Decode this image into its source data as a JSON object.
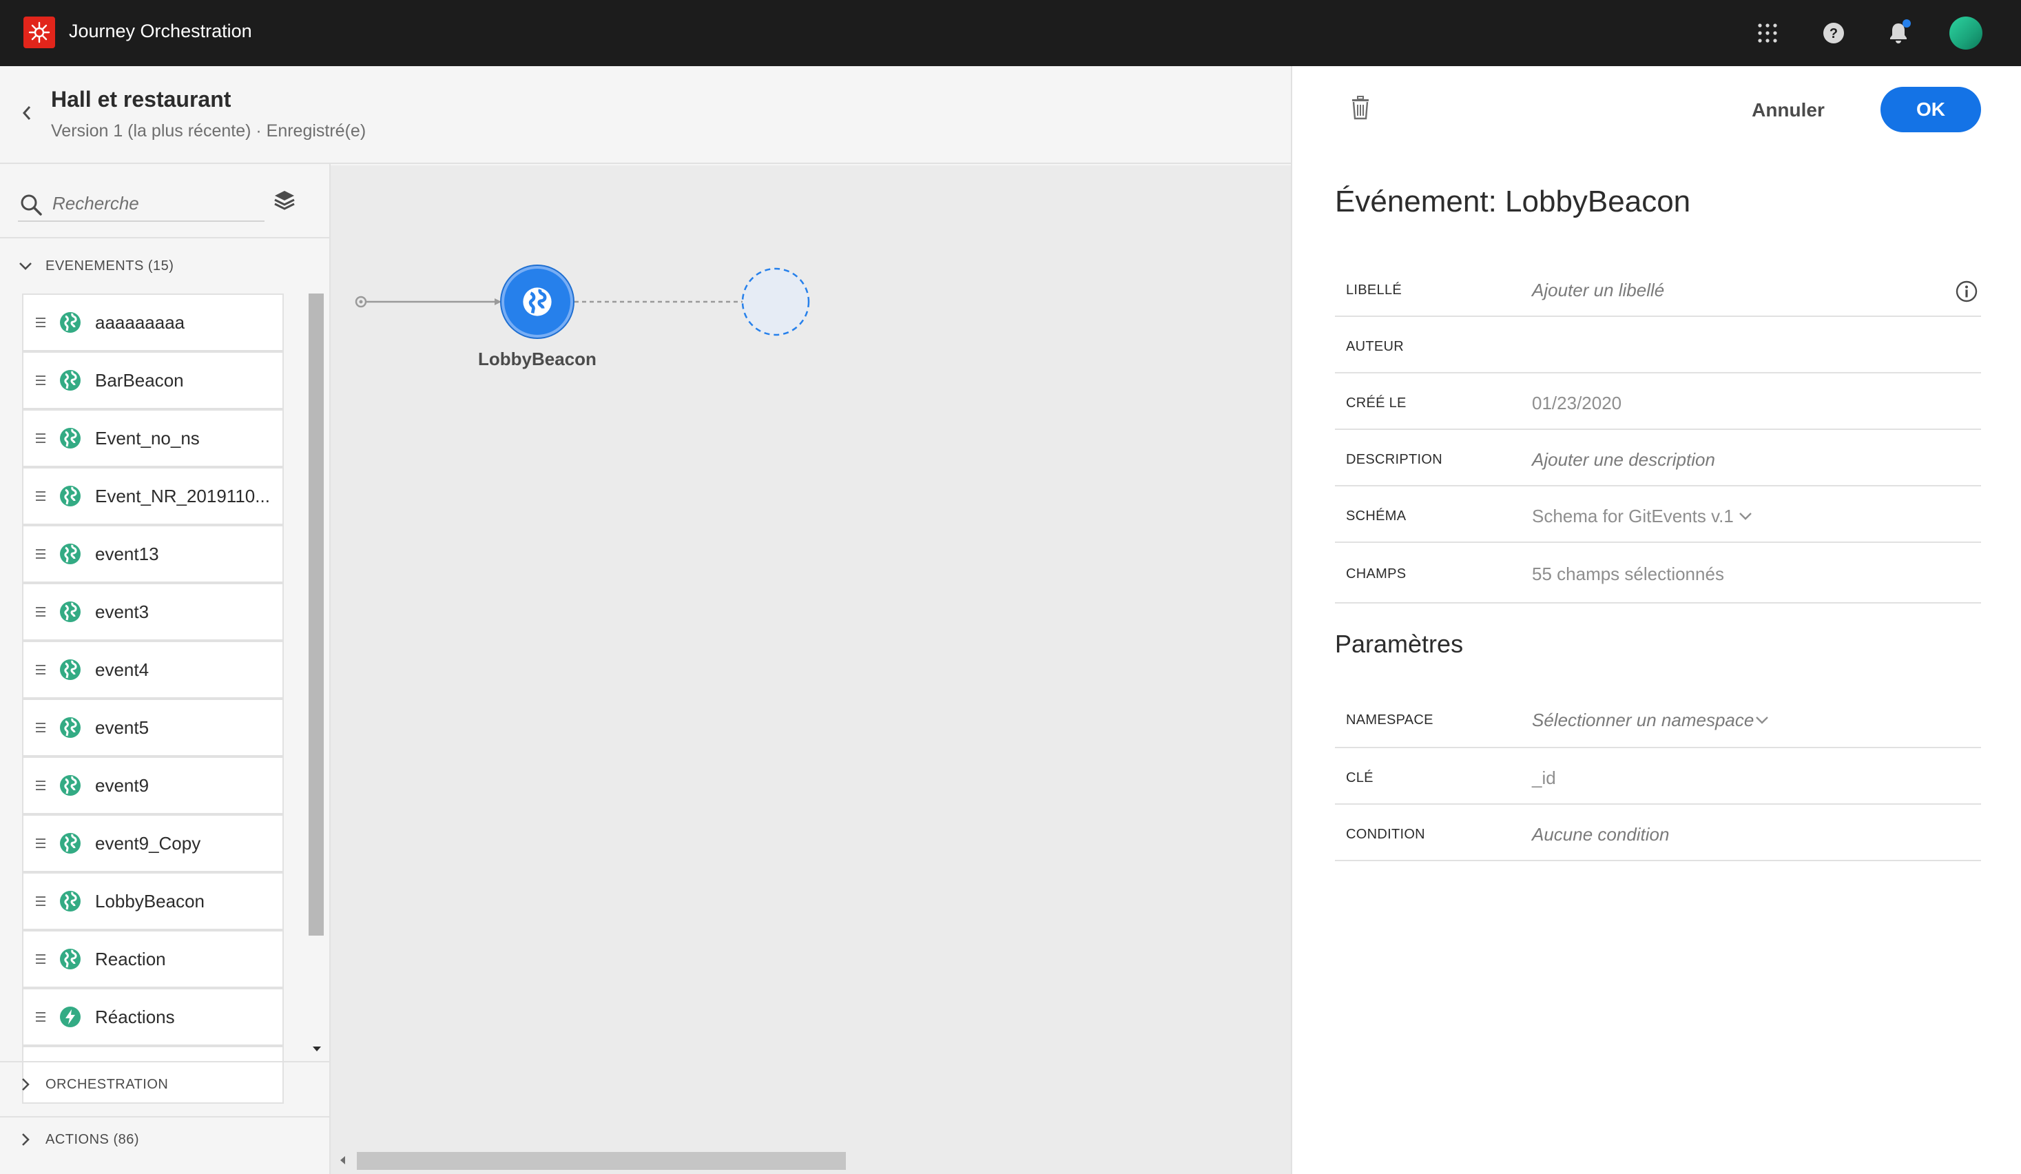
{
  "app": {
    "title": "Journey Orchestration"
  },
  "header": {
    "title": "Hall et restaurant",
    "subtitle": "Version 1 (la plus récente) · Enregistré(e)"
  },
  "sidebar": {
    "search_placeholder": "Recherche",
    "sections": {
      "events": "EVENEMENTS (15)",
      "orchestration": "ORCHESTRATION",
      "actions": "ACTIONS (86)"
    },
    "events": [
      {
        "label": "aaaaaaaaa",
        "icon": "globe-icon"
      },
      {
        "label": "BarBeacon",
        "icon": "globe-icon"
      },
      {
        "label": "Event_no_ns",
        "icon": "globe-icon"
      },
      {
        "label": "Event_NR_2019110...",
        "icon": "globe-icon"
      },
      {
        "label": "event13",
        "icon": "globe-icon"
      },
      {
        "label": "event3",
        "icon": "globe-icon"
      },
      {
        "label": "event4",
        "icon": "globe-icon"
      },
      {
        "label": "event5",
        "icon": "globe-icon"
      },
      {
        "label": "event9",
        "icon": "globe-icon"
      },
      {
        "label": "event9_Copy",
        "icon": "globe-icon"
      },
      {
        "label": "LobbyBeacon",
        "icon": "globe-icon"
      },
      {
        "label": "Reaction",
        "icon": "globe-icon"
      },
      {
        "label": "Réactions",
        "icon": "lightning-icon"
      }
    ]
  },
  "canvas": {
    "node_label": "LobbyBeacon"
  },
  "panel": {
    "cancel_label": "Annuler",
    "ok_label": "OK",
    "title": "Événement: LobbyBeacon",
    "properties": [
      {
        "label": "LIBELLÉ",
        "value": "Ajouter un libellé"
      },
      {
        "label": "AUTEUR",
        "value": ""
      },
      {
        "label": "CRÉÉ LE",
        "value": "01/23/2020"
      },
      {
        "label": "DESCRIPTION",
        "value": "Ajouter une description"
      },
      {
        "label": "SCHÉMA",
        "value": "Schema for GitEvents v.1"
      },
      {
        "label": "CHAMPS",
        "value": "55 champs sélectionnés"
      }
    ],
    "params_title": "Paramètres",
    "params": [
      {
        "label": "NAMESPACE",
        "value": "Sélectionner un namespace"
      },
      {
        "label": "CLÉ",
        "value": "_id"
      },
      {
        "label": "CONDITION",
        "value": "Aucune condition"
      }
    ]
  },
  "colors": {
    "accent": "#1473e6",
    "topbar": "#1c1c1c",
    "brand": "#e1251b",
    "event_icon": "#33ab84"
  }
}
